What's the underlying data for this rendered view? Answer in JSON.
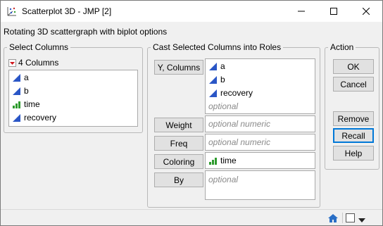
{
  "window": {
    "title": "Scatterplot 3D - JMP [2]",
    "subtitle": "Rotating 3D scattergraph with biplot options"
  },
  "select_columns": {
    "group_title": "Select Columns",
    "count_label": "4 Columns",
    "columns": [
      {
        "name": "a",
        "type": "continuous"
      },
      {
        "name": "b",
        "type": "continuous"
      },
      {
        "name": "time",
        "type": "ordinal"
      },
      {
        "name": "recovery",
        "type": "continuous"
      }
    ]
  },
  "cast_roles": {
    "group_title": "Cast Selected Columns into Roles",
    "y_columns": {
      "button": "Y, Columns",
      "items": [
        {
          "name": "a",
          "type": "continuous"
        },
        {
          "name": "b",
          "type": "continuous"
        },
        {
          "name": "recovery",
          "type": "continuous"
        }
      ],
      "placeholder": "optional"
    },
    "weight": {
      "button": "Weight",
      "placeholder": "optional numeric"
    },
    "freq": {
      "button": "Freq",
      "placeholder": "optional numeric"
    },
    "coloring": {
      "button": "Coloring",
      "value": "time",
      "value_type": "ordinal"
    },
    "by": {
      "button": "By",
      "placeholder": "optional"
    }
  },
  "action": {
    "group_title": "Action",
    "ok": "OK",
    "cancel": "Cancel",
    "remove": "Remove",
    "recall": "Recall",
    "help": "Help"
  },
  "colors": {
    "continuous_icon": "#2a56c6",
    "ordinal_icon": "#2e9b2e",
    "focus_border": "#0078d7"
  }
}
